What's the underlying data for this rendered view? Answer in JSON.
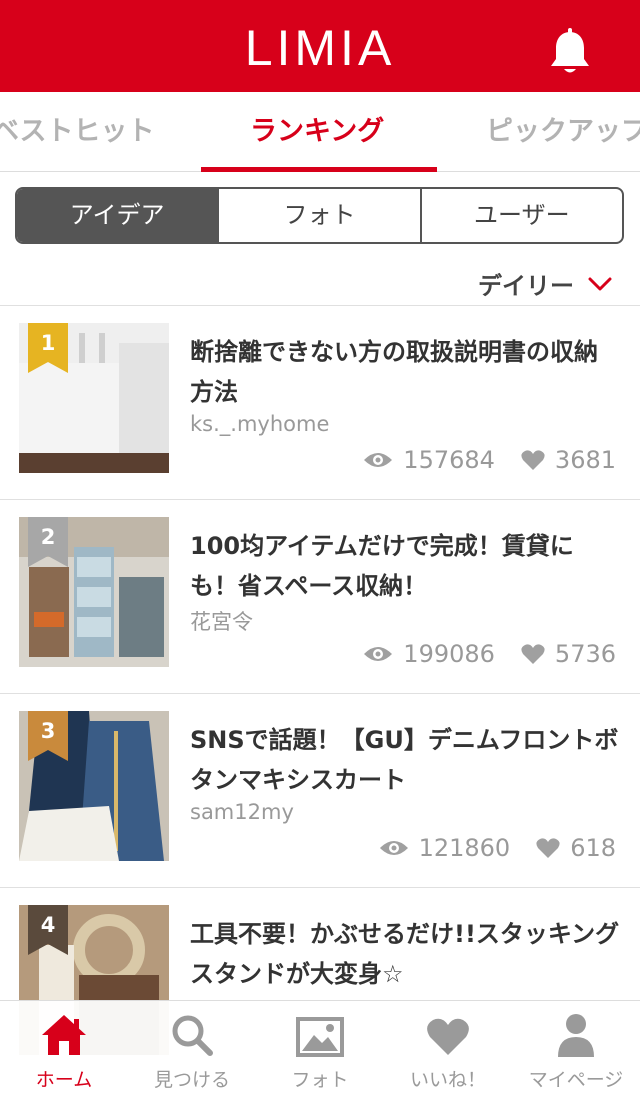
{
  "header": {
    "logo": "LIMIA",
    "icon": "bell-icon"
  },
  "tabs": [
    {
      "label": "ベストヒット"
    },
    {
      "label": "ランキング",
      "active": true
    },
    {
      "label": "ピックアップ"
    }
  ],
  "segments": [
    {
      "label": "アイデア",
      "active": true
    },
    {
      "label": "フォト"
    },
    {
      "label": "ユーザー"
    }
  ],
  "period": {
    "label": "デイリー",
    "icon": "chevron-down-icon"
  },
  "items": [
    {
      "rank": "1",
      "title": "断捨離できない方の取扱説明書の収納方法",
      "author": "ks._.myhome",
      "views": "157684",
      "likes": "3681",
      "rank_color": "#e6b422"
    },
    {
      "rank": "2",
      "title": "100均アイテムだけで完成！賃貸にも！省スペース収納！",
      "author": "花宮令",
      "views": "199086",
      "likes": "5736",
      "rank_color": "#a7a7a7"
    },
    {
      "rank": "3",
      "title": "SNSで話題！【GU】デニムフロントボタンマキシスカート",
      "author": "sam12my",
      "views": "121860",
      "likes": "618",
      "rank_color": "#c98a3c"
    },
    {
      "rank": "4",
      "title": "工具不要！かぶせるだけ!!スタッキングスタンドが大変身☆",
      "author": "",
      "views": "",
      "likes": "",
      "rank_color": "#5a4a3c"
    }
  ],
  "nav": [
    {
      "label": "ホーム",
      "icon": "home-icon",
      "active": true
    },
    {
      "label": "見つける",
      "icon": "search-icon"
    },
    {
      "label": "フォト",
      "icon": "photo-icon"
    },
    {
      "label": "いいね！",
      "icon": "heart-icon"
    },
    {
      "label": "マイページ",
      "icon": "user-icon"
    }
  ],
  "colors": {
    "brand": "#d7001a",
    "segment_active": "#555555",
    "muted": "#999999"
  }
}
